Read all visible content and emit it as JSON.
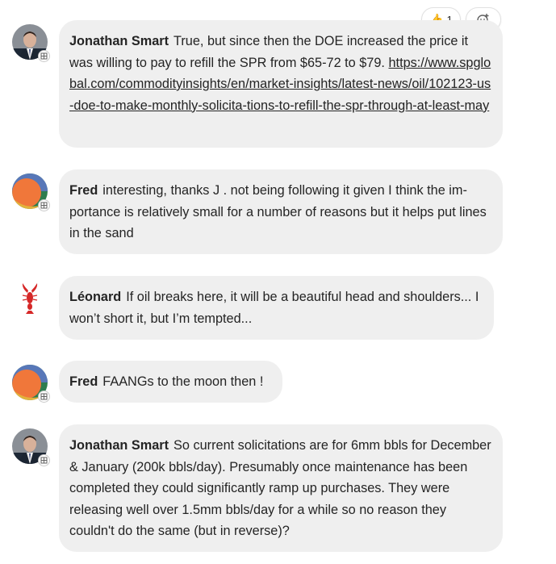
{
  "reaction": {
    "emoji": "👍",
    "count": "1"
  },
  "messages": [
    {
      "author": "Jonathan Smart",
      "text": "True, but since then the DOE increased the price it was willing to pay to refill the SPR from $65-72 to $79.",
      "link": "https://www.spglobal.com/commodityinsights/en/market-insights/latest-news/oil/102123-us-doe-to-make-monthly-solicita-tions-to-refill-the-spr-through-at-least-may"
    },
    {
      "author": "Fred",
      "text": "interesting, thanks J . not being following it given I think the im-portance is relatively small for a number of reasons but it helps put lines in the sand"
    },
    {
      "author": "Léonard",
      "text": "If oil breaks here, it will be a beautiful head and shoulders... I won’t short it, but I’m tempted..."
    },
    {
      "author": "Fred",
      "text": "FAANGs to the moon then !"
    },
    {
      "author": "Jonathan Smart",
      "text": "So current solicitations are for 6mm bbls for December & January (200k bbls/day). Presumably once maintenance has been completed they could significantly ramp up purchases. They were releasing well over 1.5mm bbls/day for a while so no reason they couldn't do the same (but in reverse)?"
    }
  ]
}
